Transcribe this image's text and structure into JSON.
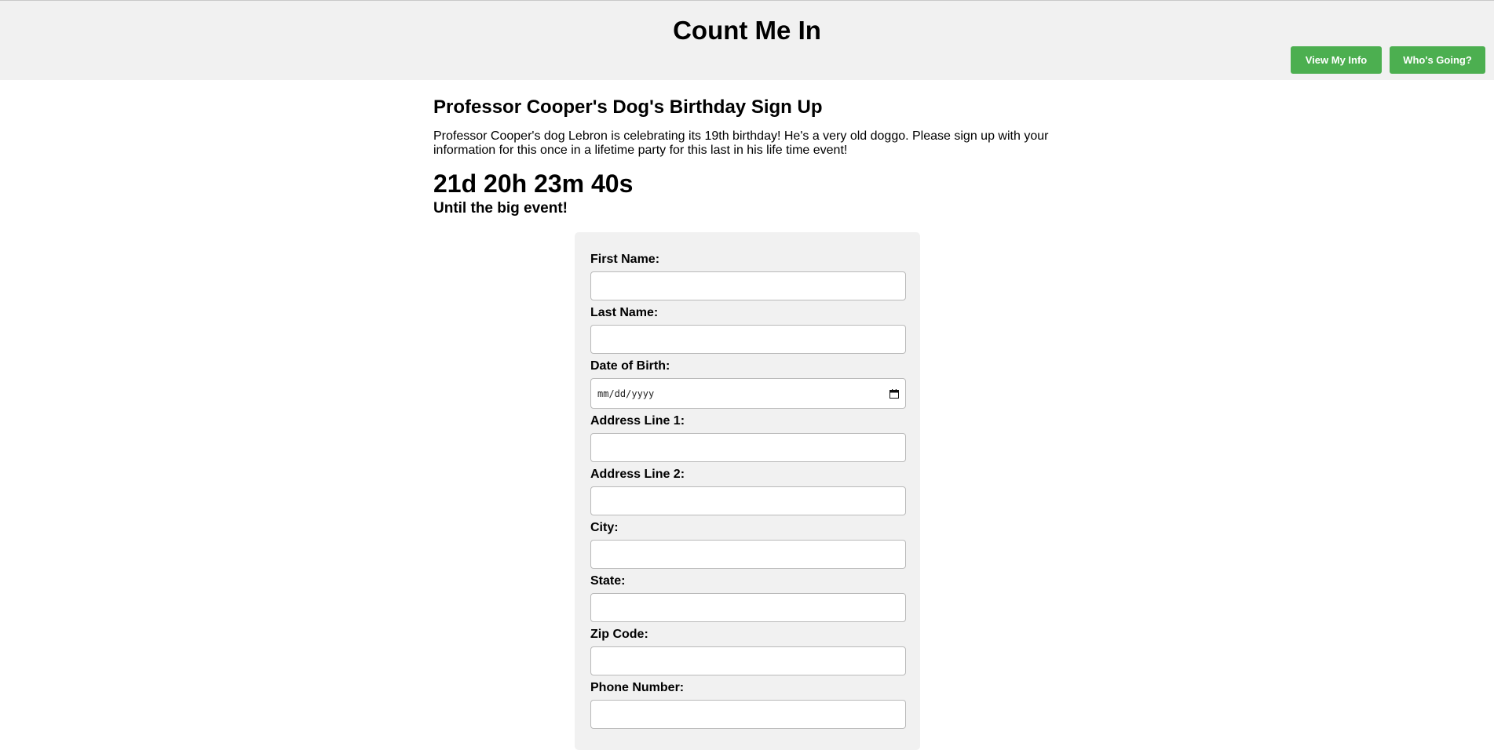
{
  "header": {
    "title": "Count Me In",
    "buttons": {
      "view_info": "View My Info",
      "whos_going": "Who's Going?"
    }
  },
  "event": {
    "title": "Professor Cooper's Dog's Birthday Sign Up",
    "description": "Professor Cooper's dog Lebron is celebrating its 19th birthday! He's a very old doggo. Please sign up with your information for this once in a lifetime party for this last in his life time event!",
    "countdown": "21d 20h 23m 40s",
    "countdown_caption": "Until the big event!"
  },
  "form": {
    "fields": [
      {
        "label": "First Name:",
        "value": ""
      },
      {
        "label": "Last Name:",
        "value": ""
      },
      {
        "label": "Date of Birth:",
        "placeholder": "mm/dd/yyyy"
      },
      {
        "label": "Address Line 1:",
        "value": ""
      },
      {
        "label": "Address Line 2:",
        "value": ""
      },
      {
        "label": "City:",
        "value": ""
      },
      {
        "label": "State:",
        "value": ""
      },
      {
        "label": "Zip Code:",
        "value": ""
      },
      {
        "label": "Phone Number:",
        "value": ""
      }
    ]
  },
  "colors": {
    "header_bg": "#f1f1f1",
    "button_green": "#4caf50",
    "form_bg": "#f1f1f1"
  },
  "icons": {
    "date_picker": "calendar-icon"
  }
}
